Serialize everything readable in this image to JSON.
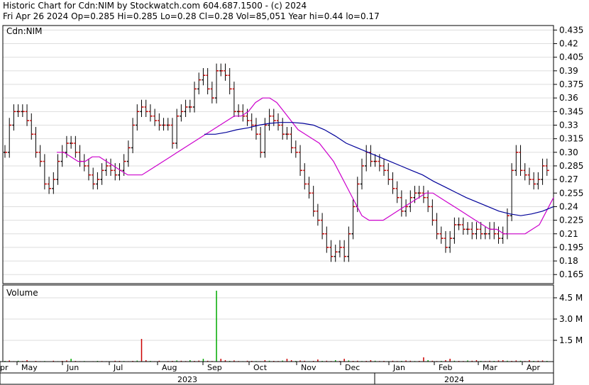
{
  "header": {
    "line1": "Historic Chart for Cdn:NIM by Stockwatch.com 604.687.1500 - (c) 2024",
    "line2": "Fri Apr 26 2024  Op=0.285  Hi=0.285  Lo=0.28  Cl=0.28  Vol=85,051  Year hi=0.44  lo=0.17"
  },
  "price_panel": {
    "symbol_label": "Cdn:NIM"
  },
  "volume_panel": {
    "label": "Volume"
  },
  "chart_data": {
    "type": "ohlc",
    "y_ticks": [
      "0.435",
      "0.42",
      "0.405",
      "0.39",
      "0.375",
      "0.36",
      "0.345",
      "0.33",
      "0.315",
      "0.30",
      "0.285",
      "0.27",
      "0.255",
      "0.24",
      "0.225",
      "0.21",
      "0.195",
      "0.18",
      "0.165"
    ],
    "ylim": [
      0.155,
      0.44
    ],
    "volume_ticks": [
      "4.5 M",
      "3.0 M",
      "1.5 M"
    ],
    "months": [
      "pr",
      "May",
      "Jun",
      "Jul",
      "Aug",
      "Sep",
      "Oct",
      "Nov",
      "Dec",
      "Jan",
      "Feb",
      "Mar",
      "Apr"
    ],
    "years": [
      "2023",
      "2024"
    ],
    "colors": {
      "up": "#000000",
      "down": "#cc0000",
      "ma_short": "#cc00cc",
      "ma_long": "#000099",
      "vol_up": "#00aa00",
      "vol_down": "#cc0000",
      "grid": "#dddddd",
      "frame": "#000000"
    },
    "close_series": [
      0.3,
      0.33,
      0.345,
      0.345,
      0.345,
      0.335,
      0.32,
      0.3,
      0.29,
      0.265,
      0.26,
      0.27,
      0.29,
      0.3,
      0.31,
      0.31,
      0.3,
      0.29,
      0.285,
      0.275,
      0.265,
      0.27,
      0.28,
      0.285,
      0.28,
      0.275,
      0.28,
      0.29,
      0.305,
      0.33,
      0.345,
      0.35,
      0.345,
      0.34,
      0.335,
      0.33,
      0.33,
      0.33,
      0.31,
      0.34,
      0.345,
      0.35,
      0.35,
      0.37,
      0.38,
      0.385,
      0.37,
      0.36,
      0.39,
      0.39,
      0.385,
      0.37,
      0.345,
      0.345,
      0.34,
      0.335,
      0.33,
      0.32,
      0.3,
      0.33,
      0.34,
      0.335,
      0.33,
      0.32,
      0.32,
      0.305,
      0.3,
      0.28,
      0.265,
      0.255,
      0.235,
      0.225,
      0.21,
      0.195,
      0.185,
      0.19,
      0.195,
      0.185,
      0.21,
      0.24,
      0.265,
      0.285,
      0.3,
      0.29,
      0.29,
      0.285,
      0.28,
      0.27,
      0.26,
      0.25,
      0.235,
      0.24,
      0.25,
      0.255,
      0.255,
      0.25,
      0.24,
      0.225,
      0.21,
      0.205,
      0.195,
      0.205,
      0.22,
      0.22,
      0.215,
      0.215,
      0.21,
      0.215,
      0.21,
      0.21,
      0.215,
      0.21,
      0.205,
      0.21,
      0.23,
      0.28,
      0.3,
      0.28,
      0.275,
      0.27,
      0.265,
      0.27,
      0.285,
      0.28
    ],
    "ma_short_series": [
      0.3,
      0.3,
      0.295,
      0.29,
      0.29,
      0.295,
      0.295,
      0.29,
      0.285,
      0.28,
      0.275,
      0.275,
      0.275,
      0.28,
      0.285,
      0.29,
      0.295,
      0.3,
      0.305,
      0.31,
      0.315,
      0.32,
      0.325,
      0.33,
      0.335,
      0.34,
      0.34,
      0.345,
      0.355,
      0.36,
      0.36,
      0.355,
      0.345,
      0.335,
      0.325,
      0.32,
      0.315,
      0.31,
      0.3,
      0.29,
      0.275,
      0.26,
      0.245,
      0.23,
      0.225,
      0.225,
      0.225,
      0.23,
      0.235,
      0.24,
      0.245,
      0.25,
      0.255,
      0.255,
      0.25,
      0.245,
      0.24,
      0.235,
      0.23,
      0.225,
      0.22,
      0.215,
      0.215,
      0.21,
      0.21,
      0.21,
      0.21,
      0.215,
      0.22,
      0.235,
      0.25
    ],
    "ma_long_series": [
      0.32,
      0.32,
      0.322,
      0.325,
      0.327,
      0.33,
      0.332,
      0.333,
      0.333,
      0.332,
      0.33,
      0.325,
      0.318,
      0.31,
      0.305,
      0.3,
      0.295,
      0.29,
      0.285,
      0.28,
      0.275,
      0.268,
      0.262,
      0.256,
      0.25,
      0.245,
      0.24,
      0.235,
      0.232,
      0.23,
      0.232,
      0.235,
      0.24
    ],
    "volume_series_millions": [
      0.05,
      0.08,
      0.03,
      0.06,
      0.04,
      0.1,
      0.02,
      0.05,
      0.03,
      0.04,
      0.02,
      0.06,
      0.03,
      0.05,
      0.08,
      0.2,
      0.05,
      0.03,
      0.04,
      0.02,
      0.03,
      0.05,
      0.04,
      0.03,
      0.02,
      0.06,
      0.05,
      0.04,
      0.03,
      0.05,
      0.07,
      1.6,
      0.1,
      0.05,
      0.03,
      0.06,
      0.02,
      0.04,
      0.05,
      0.08,
      0.06,
      0.04,
      0.1,
      0.05,
      0.07,
      0.2,
      0.06,
      0.04,
      5.0,
      0.2,
      0.1,
      0.05,
      0.08,
      0.04,
      0.03,
      0.06,
      0.05,
      0.04,
      0.03,
      0.1,
      0.06,
      0.05,
      0.04,
      0.07,
      0.2,
      0.1,
      0.05,
      0.08,
      0.06,
      0.03,
      0.05,
      0.15,
      0.05,
      0.06,
      0.04,
      0.1,
      0.05,
      0.2,
      0.08,
      0.05,
      0.06,
      0.04,
      0.05,
      0.1,
      0.06,
      0.04,
      0.05,
      0.03,
      0.06,
      0.04,
      0.05,
      0.08,
      0.06,
      0.04,
      0.05,
      0.3,
      0.1,
      0.06,
      0.04,
      0.05,
      0.1,
      0.2,
      0.06,
      0.05,
      0.04,
      0.08,
      0.06,
      0.1,
      0.05,
      0.04,
      0.06,
      0.05,
      0.08,
      0.1,
      0.06,
      0.05,
      0.08,
      0.06,
      0.04,
      0.1,
      0.05,
      0.06,
      0.08,
      0.05
    ]
  }
}
